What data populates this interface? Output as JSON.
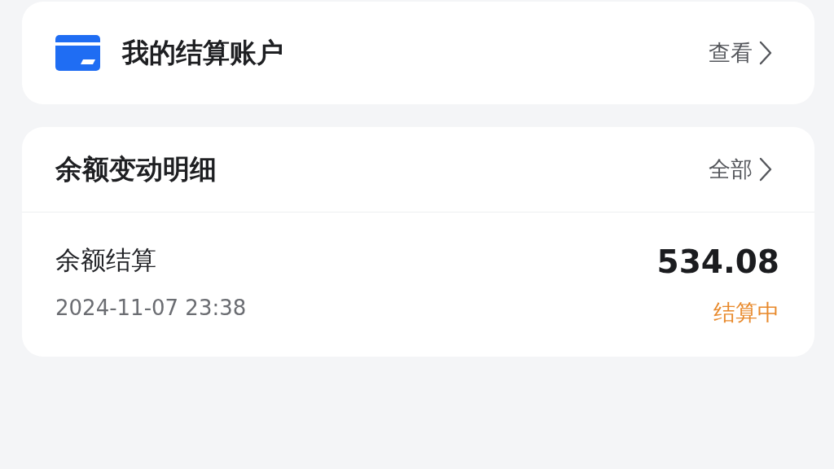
{
  "account_card": {
    "title": "我的结算账户",
    "action": "查看"
  },
  "balance_card": {
    "title": "余额变动明细",
    "action": "全部",
    "entries": [
      {
        "name": "余额结算",
        "time": "2024-11-07 23:38",
        "amount": "534.08",
        "status": "结算中",
        "color": "#e8892b"
      }
    ]
  }
}
